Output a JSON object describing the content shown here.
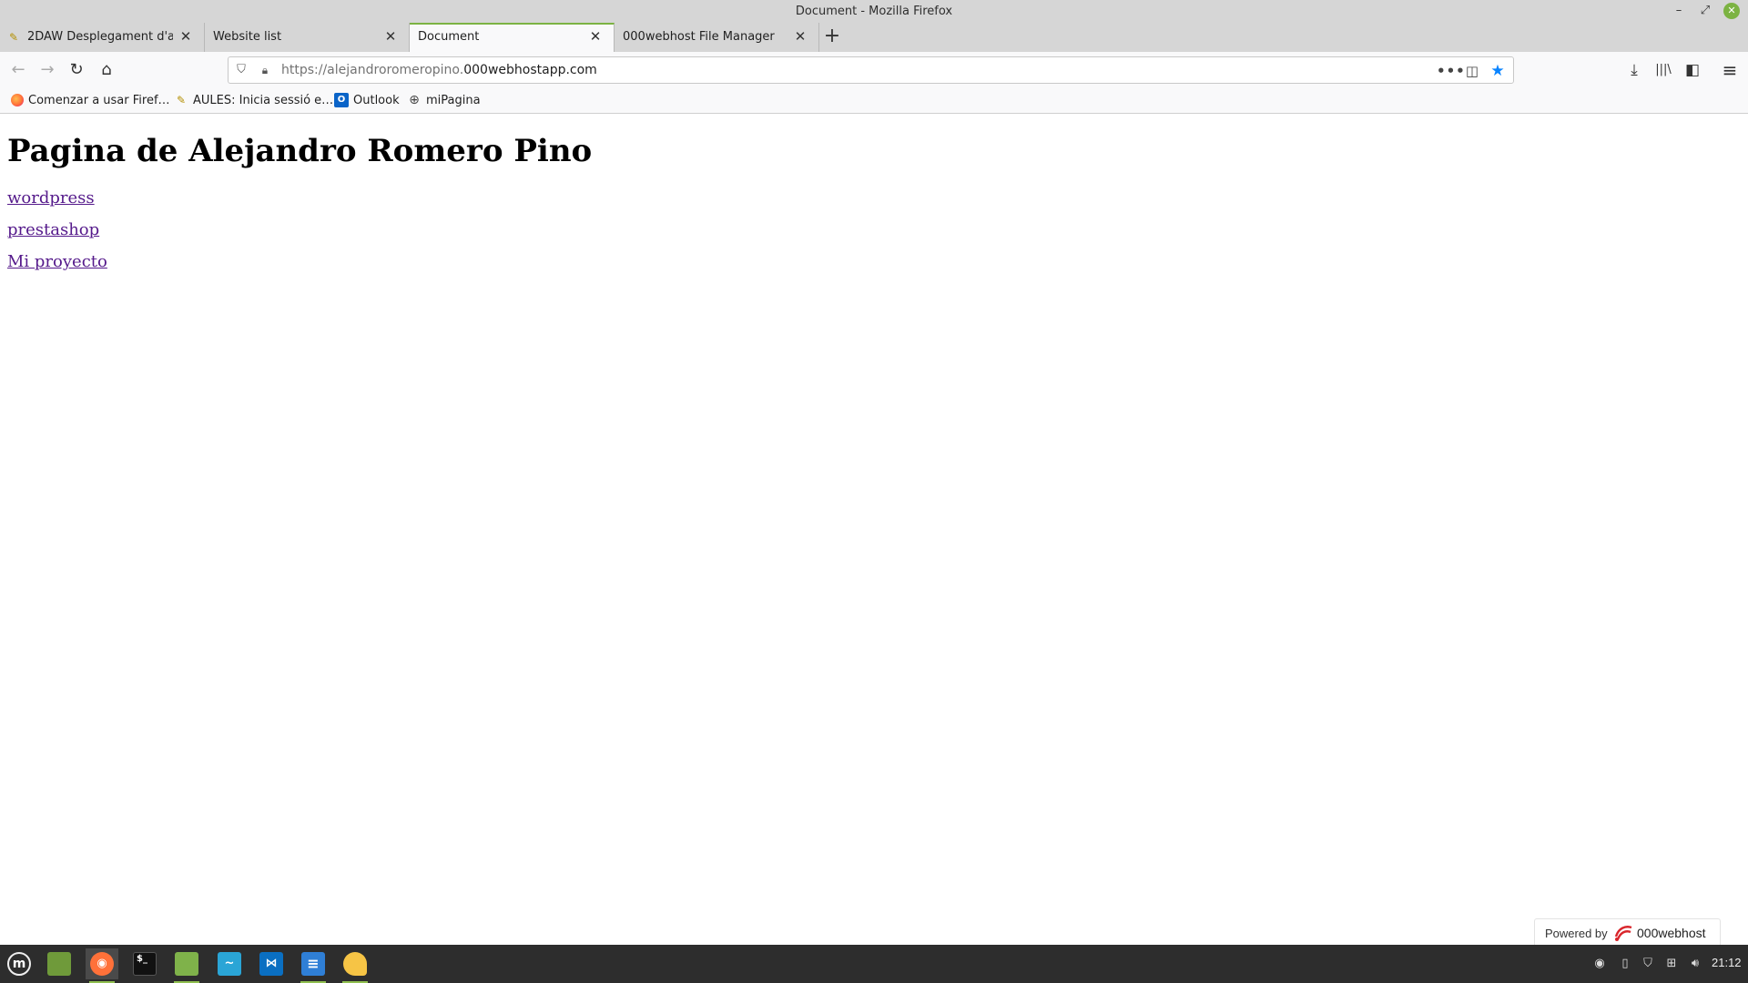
{
  "window": {
    "title": "Document - Mozilla Firefox",
    "minimize_glyph": "–",
    "maximize_glyph": "⤢",
    "close_glyph": "✕"
  },
  "tabs": [
    {
      "label": "2DAW Desplegament d'apl",
      "icon": "note-icon",
      "active": false
    },
    {
      "label": "Website list",
      "icon": "",
      "active": false
    },
    {
      "label": "Document",
      "icon": "",
      "active": true
    },
    {
      "label": "000webhost File Manager",
      "icon": "",
      "active": false
    }
  ],
  "tab_close_glyph": "✕",
  "new_tab_glyph": "+",
  "navbar": {
    "back_glyph": "←",
    "forward_glyph": "→",
    "reload_glyph": "↻",
    "home_glyph": "⌂",
    "url_prefix": "https://alejandroromeropino.",
    "url_domain": "000webhostapp.com",
    "more_glyph": "•••",
    "pocket_glyph": "◫",
    "star_glyph": "★",
    "downloads_glyph": "⤓",
    "library_glyph": "|||\\",
    "sidebar_glyph": "◧",
    "menu_glyph": "≡"
  },
  "bookmarks": [
    {
      "label": "Comenzar a usar Firef…",
      "icon": "firefox-icon"
    },
    {
      "label": "AULES: Inicia sessió e…",
      "icon": "note-icon"
    },
    {
      "label": "Outlook",
      "icon": "outlook-icon"
    },
    {
      "label": "miPagina",
      "icon": "globe-icon"
    }
  ],
  "page": {
    "heading": "Pagina de Alejandro Romero Pino",
    "links": [
      "wordpress",
      "prestashop",
      "Mi proyecto"
    ],
    "powered_label": "Powered by",
    "powered_brand": "000webhost"
  },
  "taskbar": {
    "clock": "21:12",
    "apps": [
      "mint-menu",
      "show-desktop",
      "firefox",
      "terminal",
      "files",
      "system-monitor",
      "vscode",
      "text-editor",
      "sticky-notes"
    ]
  },
  "colors": {
    "accent_green": "#7cb342",
    "link_visited": "#551a8b",
    "star_blue": "#0a84ff",
    "taskbar_bg": "#2d2d2d"
  }
}
